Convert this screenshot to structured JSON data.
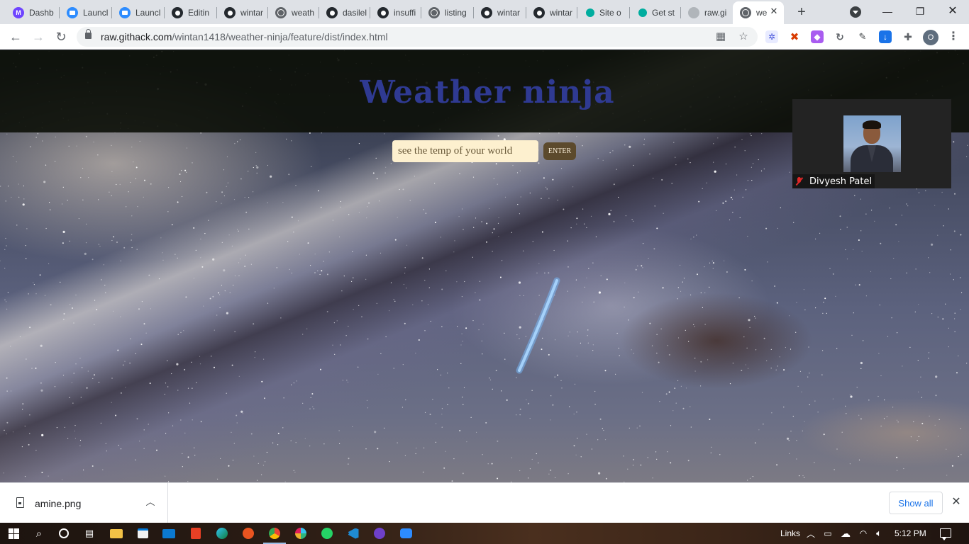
{
  "browser": {
    "tabs": [
      {
        "label": "Dashb",
        "icon": "purple-app-icon"
      },
      {
        "label": "Launcl",
        "icon": "zoom-icon"
      },
      {
        "label": "Launcl",
        "icon": "zoom-icon"
      },
      {
        "label": "Editin",
        "icon": "github-icon"
      },
      {
        "label": "wintar",
        "icon": "github-icon"
      },
      {
        "label": "weath",
        "icon": "globe-icon"
      },
      {
        "label": "dasilel",
        "icon": "github-icon"
      },
      {
        "label": "insuffi",
        "icon": "github-icon"
      },
      {
        "label": "listing",
        "icon": "globe-icon"
      },
      {
        "label": "wintar",
        "icon": "github-icon"
      },
      {
        "label": "wintar",
        "icon": "github-icon"
      },
      {
        "label": "Site o",
        "icon": "netlify-icon"
      },
      {
        "label": "Get st",
        "icon": "netlify-icon"
      },
      {
        "label": "raw.gi",
        "icon": "githack-icon"
      },
      {
        "label": "we",
        "icon": "globe-icon"
      }
    ],
    "url_host": "raw.githack.com",
    "url_path": "/wintan1418/weather-ninja/feature/dist/index.html",
    "profile_initial": "O"
  },
  "page": {
    "title": "Weather ninja",
    "search_placeholder": "see the temp of your world",
    "enter_label": "ENTER"
  },
  "zoom": {
    "participant_name": "Divyesh Patel"
  },
  "downloads": {
    "file_name": "amine.png",
    "show_all_label": "Show all"
  },
  "taskbar": {
    "links_label": "Links",
    "time": "5:12 PM"
  },
  "colors": {
    "title": "#2f3a92",
    "input_bg": "#fdf0cf",
    "enter_bg": "#5c4a2c"
  }
}
